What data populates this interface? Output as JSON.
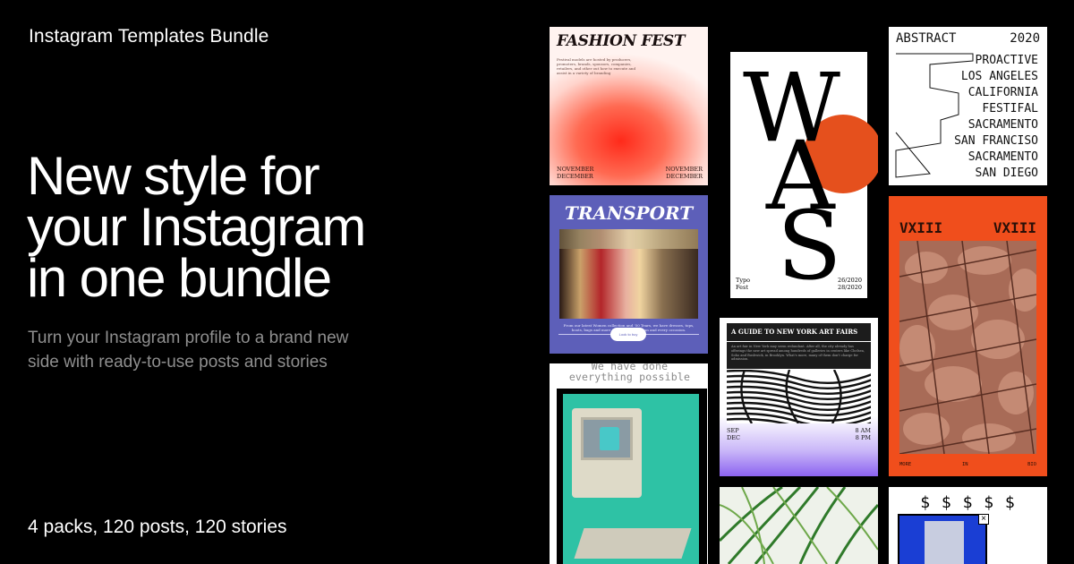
{
  "brand_title": "Instagram Templates Bundle",
  "headline": [
    "New style for",
    "your Instagram",
    "in one bundle"
  ],
  "subheadline": [
    "Turn your Instagram profile to a brand new",
    "side with ready-to-use posts and stories"
  ],
  "stats": "4 packs, 120 posts, 120 stories",
  "templates": {
    "fashion": {
      "title": "FASHION FEST",
      "body": "Festival models are hosted by producers, promoters, brands, sponsors, companies, retailers, and other out how to execute and assist in a variety of branding",
      "date_left": [
        "NOVEMBER",
        "DECEMBER"
      ],
      "date_right": [
        "NOVEMBER",
        "DECEMBER"
      ]
    },
    "transport": {
      "title": "TRANSPORT",
      "body": "From our latest Women collection and '50 Tears, we have dresses, tops, boots, bags and more to suit every woman and every occasion.",
      "button": "Look to buy"
    },
    "retro": {
      "lines": [
        "We have done",
        "everything possible"
      ]
    },
    "was": {
      "letters": [
        "W",
        "A",
        "S"
      ],
      "left_meta": [
        "Typo",
        "Fest"
      ],
      "right_meta": [
        "26/2020",
        "28/2020"
      ]
    },
    "artfairs": {
      "title": "A GUIDE TO NEW YORK ART FAIRS",
      "body": "An art fair in New York may seem redundant. After all, the city already has offerings the new art spread among hundreds of galleries in centers like Chelsea, Soho and Bushwick, in Brooklyn. What's more, many of them don't charge for admission.",
      "dates": [
        "SEP",
        "DEC"
      ],
      "times": [
        "8 AM",
        "8 PM"
      ]
    },
    "abstract": {
      "left": "ABSTRACT",
      "right": "2020",
      "list": [
        "PROACTIVE",
        "LOS ANGELES",
        "CALIFORNIA",
        "FESTIFAL",
        "SACRAMENTO",
        "SAN FRANCISO",
        "SACRAMENTO",
        "SAN DIEGO"
      ]
    },
    "vxiii": {
      "left": "VXIII",
      "right": "VXIII",
      "footer": [
        "MORE",
        "IN",
        "BIO"
      ]
    },
    "dollar": {
      "coins": "$ $ $ $ $",
      "close": "×"
    }
  },
  "colors": {
    "background": "#000000",
    "subtext": "#8f8f8f",
    "transport": "#5d5fb9",
    "vxiii": "#f04e1c",
    "was_sun": "#e5501d",
    "retro_teal": "#2ec2a5"
  }
}
